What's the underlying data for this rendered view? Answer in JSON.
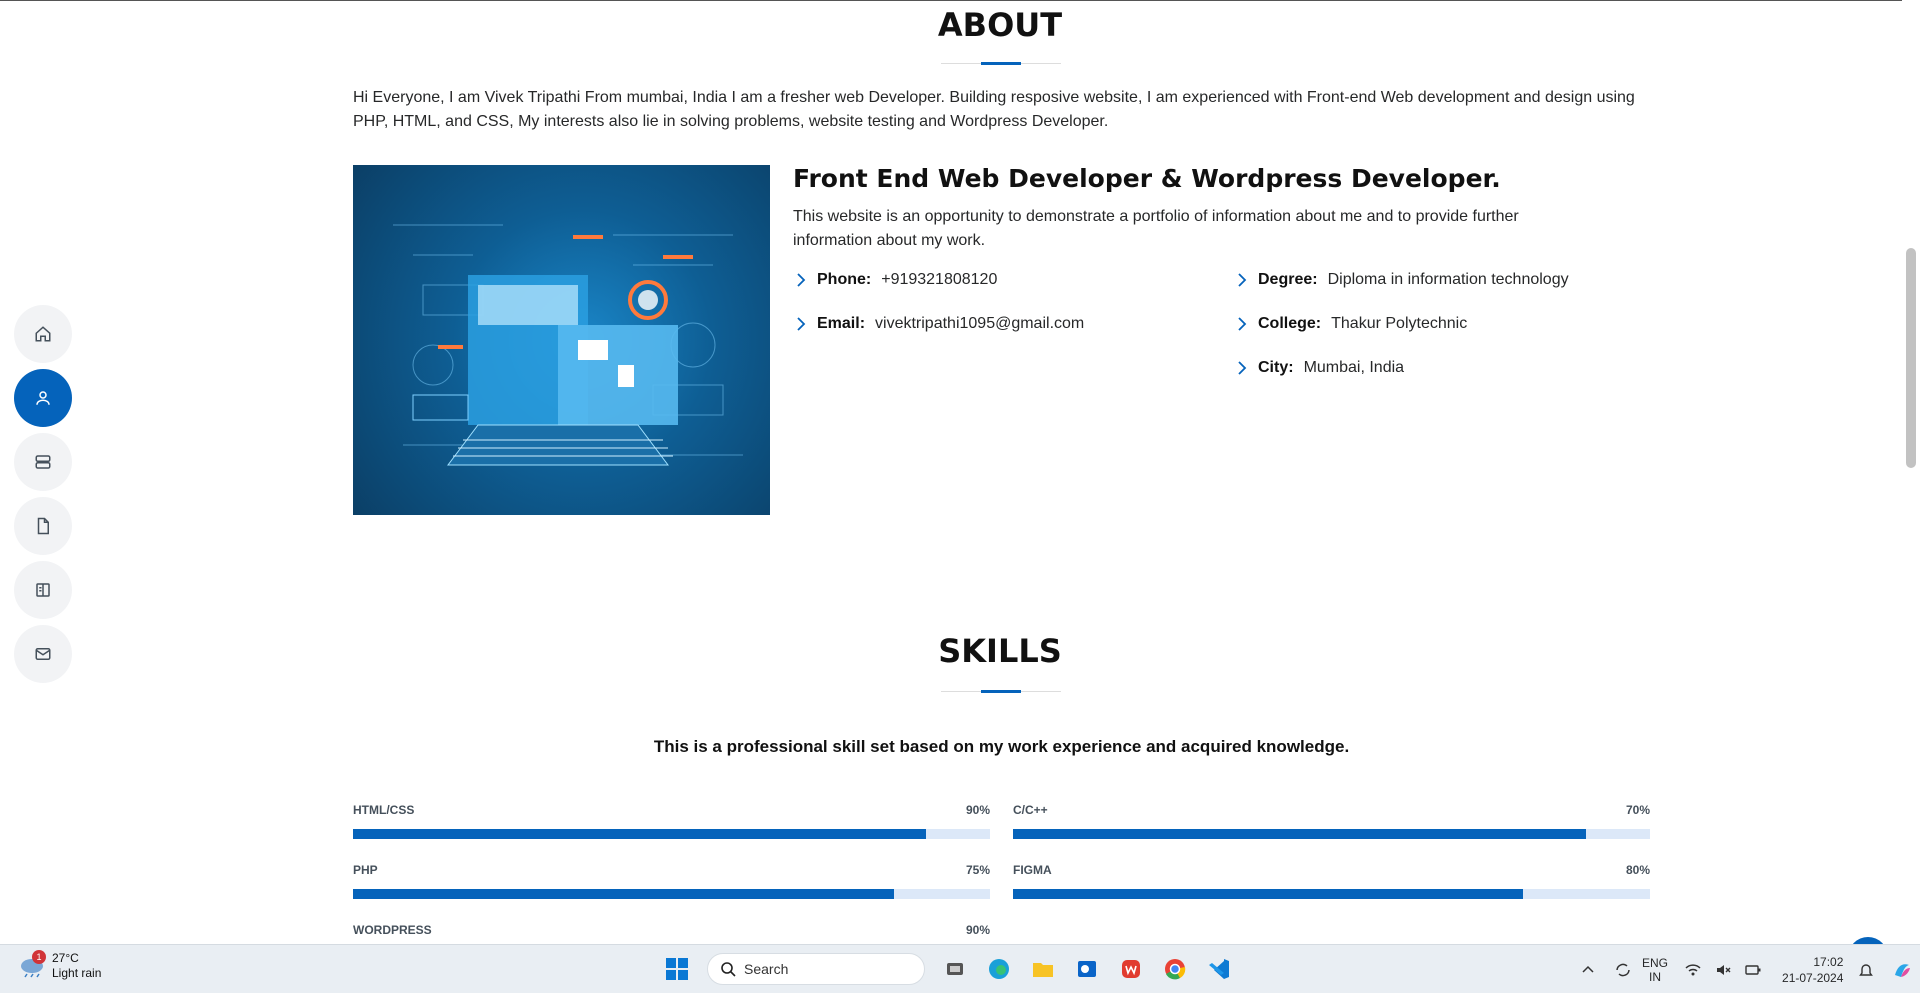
{
  "about": {
    "title": "ABOUT",
    "intro": "Hi Everyone, I am Vivek Tripathi From mumbai, India I am a fresher web Developer. Building resposive website, I am experienced with Front-end Web development and design using PHP, HTML, and CSS, My interests also lie in solving problems, website testing and Wordpress Developer.",
    "profile_title": "Front End Web Developer & Wordpress Developer.",
    "profile_desc": "This website is an opportunity to demonstrate a portfolio of information about me and to provide further information about my work.",
    "info_left": [
      {
        "label": "Phone:",
        "value": "+919321808120"
      },
      {
        "label": "Email:",
        "value": "vivektripathi1095@gmail.com"
      }
    ],
    "info_right": [
      {
        "label": "Degree:",
        "value": "Diploma in information technology"
      },
      {
        "label": "College:",
        "value": "Thakur Polytechnic"
      },
      {
        "label": "City:",
        "value": "Mumbai, India"
      }
    ]
  },
  "skills": {
    "title": "SKILLS",
    "subtitle": "This is a professional skill set based on my work experience and acquired knowledge.",
    "items": [
      {
        "name": "HTML/CSS",
        "percent_label": "90%",
        "level": 0.9
      },
      {
        "name": "C/C++",
        "percent_label": "70%",
        "level": 0.9
      },
      {
        "name": "PHP",
        "percent_label": "75%",
        "level": 0.85
      },
      {
        "name": "FIGMA",
        "percent_label": "80%",
        "level": 0.8
      },
      {
        "name": "WORDPRESS",
        "percent_label": "90%",
        "level": 0.9
      }
    ]
  },
  "sidenav": {
    "icons": [
      "home-icon",
      "person-icon",
      "server-icon",
      "file-icon",
      "book-icon",
      "envelope-icon"
    ],
    "active": "person-icon"
  },
  "taskbar": {
    "weather_badge": "1",
    "temperature": "27°C",
    "condition": "Light rain",
    "search_placeholder": "Search",
    "lang_top": "ENG",
    "lang_bottom": "IN",
    "time": "17:02",
    "date": "21-07-2024"
  },
  "colors": {
    "accent": "#0563bb",
    "nav_inactive": "#f2f3f5",
    "skill_track": "#dce8f8"
  }
}
